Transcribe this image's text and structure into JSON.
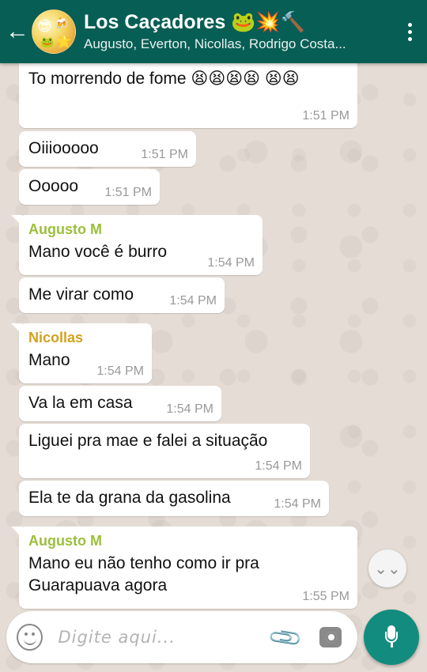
{
  "header": {
    "title": "Los Caçadores 🐸💥🔨",
    "subtitle": "Augusto, Everton, Nicollas, Rodrigo Costa...",
    "avatar_emojis": [
      "😎",
      "🍻",
      "🐸",
      "🌟"
    ],
    "colors": {
      "bar": "#075e54",
      "mic": "#128c7e"
    }
  },
  "messages": [
    {
      "sender": "",
      "text": "To morrendo de fome 😫😫😫😫 😫😫",
      "time": "1:51 PM"
    },
    {
      "sender": "",
      "text": "Oiiiooooo",
      "time": "1:51 PM"
    },
    {
      "sender": "",
      "text": "Ooooo",
      "time": "1:51 PM"
    },
    {
      "sender": "Augusto M",
      "text": "Mano você é burro",
      "time": "1:54 PM"
    },
    {
      "sender": "",
      "text": "Me virar como",
      "time": "1:54 PM"
    },
    {
      "sender": "Nicollas",
      "text": "Mano",
      "time": "1:54 PM"
    },
    {
      "sender": "",
      "text": "Va la em casa",
      "time": "1:54 PM"
    },
    {
      "sender": "",
      "text": "Liguei pra mae e falei a situação",
      "time": "1:54 PM"
    },
    {
      "sender": "",
      "text": "Ela te da grana da gasolina",
      "time": "1:54 PM"
    },
    {
      "sender": "Augusto M",
      "text": "Mano eu não tenho como ir pra Guarapuava agora",
      "time": "1:55 PM"
    }
  ],
  "composer": {
    "placeholder": "Digite aqui...",
    "icons": [
      "emoji-icon",
      "paperclip-icon",
      "camera-icon",
      "microphone-icon"
    ]
  }
}
